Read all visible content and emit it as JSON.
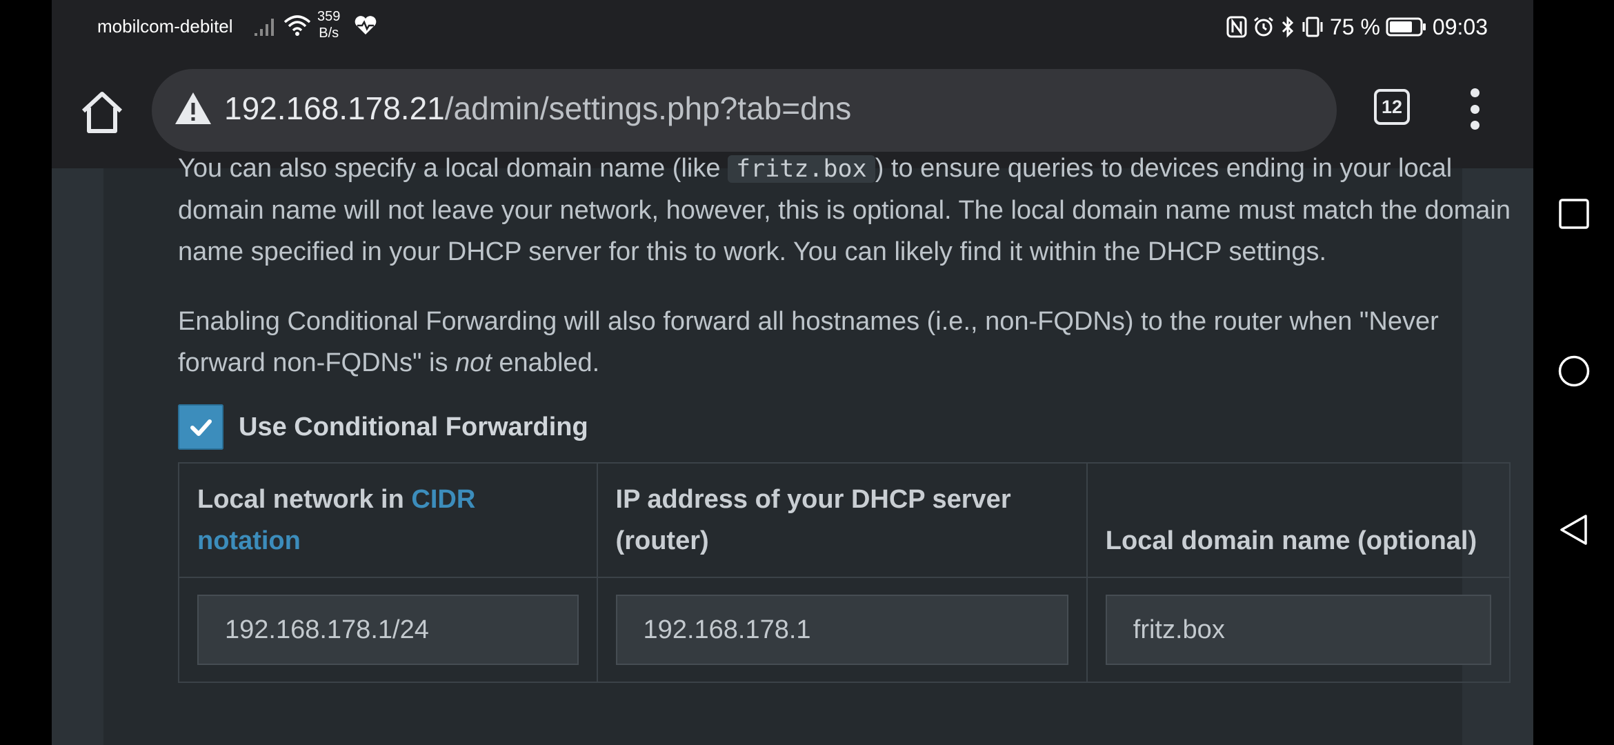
{
  "status_bar": {
    "carrier": "mobilcom-debitel",
    "speed_value": "359",
    "speed_unit": "B/s",
    "battery": "75 %",
    "time": "09:03"
  },
  "browser": {
    "url_host": "192.168.178.21",
    "url_path": "/admin/settings.php?tab=dns",
    "tab_count": "12"
  },
  "content": {
    "para1_before": "You can also specify a local domain name (like ",
    "para1_code": "fritz.box",
    "para1_after": ") to ensure queries to devices ending in your local domain name will not leave your network, however, this is optional. The local domain name must match the domain name specified in your DHCP server for this to work. You can likely find it within the DHCP settings.",
    "para2_before": "Enabling Conditional Forwarding will also forward all hostnames (i.e., non-FQDNs) to the router when \"Never forward non-FQDNs\" is ",
    "para2_em": "not",
    "para2_after": " enabled.",
    "checkbox_label": "Use Conditional Forwarding",
    "checkbox_checked": true
  },
  "table": {
    "col1_prefix": "Local network in ",
    "col1_link": "CIDR notation",
    "col2_header": "IP address of your DHCP server (router)",
    "col3_header": "Local domain name (optional)",
    "cidr_value": "192.168.178.1/24",
    "router_ip_value": "192.168.178.1",
    "domain_value": "fritz.box"
  },
  "colors": {
    "accent": "#3c8dbc",
    "background": "#252a2e",
    "toolbar": "#202124"
  }
}
